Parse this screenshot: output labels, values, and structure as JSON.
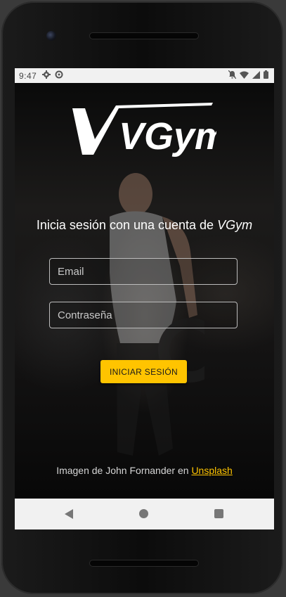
{
  "status_bar": {
    "time": "9:47",
    "left_icons": [
      "gear-icon",
      "data-saver-icon"
    ],
    "right_icons": [
      "mute-icon",
      "wifi-icon",
      "signal-icon",
      "battery-icon"
    ]
  },
  "app": {
    "logo_text": "VGym",
    "headline_prefix": "Inicia sesión con una cuenta de",
    "headline_brand": "VGym",
    "email_placeholder": "Email",
    "password_placeholder": "Contraseña",
    "login_button": "INICIAR SESIÓN",
    "credit_prefix": "Imagen de John Fornander en",
    "credit_link": "Unsplash"
  },
  "colors": {
    "accent": "#ffc400",
    "text": "#ffffff",
    "field_border": "#bcbcbc"
  },
  "nav_bar": {
    "icons": [
      "back-icon",
      "home-icon",
      "recents-icon"
    ]
  }
}
